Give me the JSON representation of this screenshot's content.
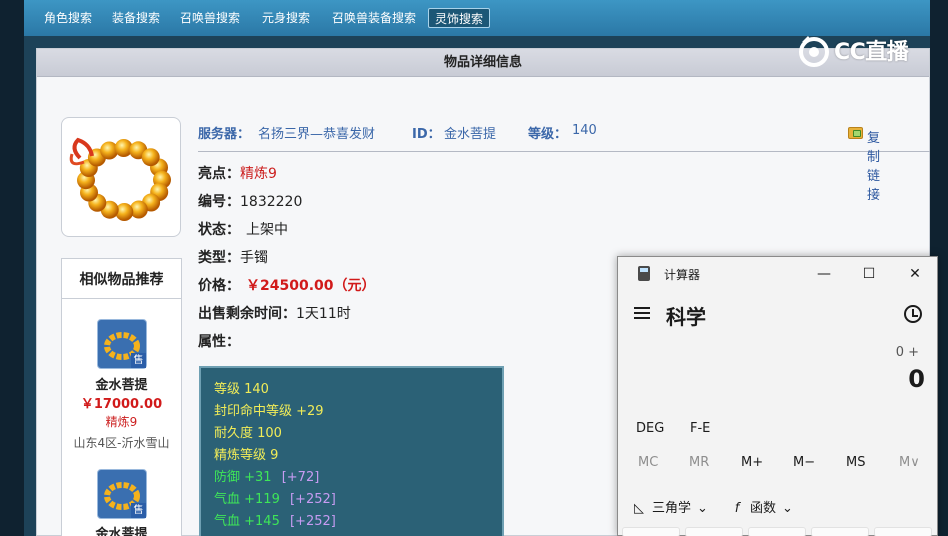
{
  "nav": {
    "tabs": [
      {
        "label": "角色搜索"
      },
      {
        "label": "装备搜索"
      },
      {
        "label": "召唤兽搜索"
      },
      {
        "label": "元身搜索"
      },
      {
        "label": "召唤兽装备搜索"
      },
      {
        "label": "灵饰搜索"
      }
    ],
    "active_tab": "灵饰搜索"
  },
  "watermark": {
    "brand": "CC直播"
  },
  "panel": {
    "title": "物品详细信息"
  },
  "info_head": {
    "server_label": "服务器：",
    "server_value": "名扬三界—恭喜发财",
    "id_label": "ID：",
    "id_value": "金水菩提",
    "level_label": "等级：",
    "level_value": "140",
    "copy_link": "复制链接"
  },
  "details": {
    "highlight_label": "亮点：",
    "highlight_value": "精炼9",
    "serial_label": "编号：",
    "serial_value": "1832220",
    "status_label": "状态：",
    "status_value": "上架中",
    "type_label": "类型：",
    "type_value": "手镯",
    "price_label": "价格：",
    "price_value": "￥24500.00（元）",
    "remain_label": "出售剩余时间：",
    "remain_value": "1天11时",
    "attr_label": "属性："
  },
  "attributes": [
    {
      "text": "等级 140"
    },
    {
      "text": "封印命中等级 +29"
    },
    {
      "text": "耐久度 100"
    },
    {
      "text": "精炼等级 9"
    },
    {
      "text": "防御 +31",
      "extra": "[+72]"
    },
    {
      "text": "气血 +119",
      "extra": "[+252]"
    },
    {
      "text": "气血 +145",
      "extra": "[+252]"
    }
  ],
  "similar": {
    "title": "相似物品推荐",
    "sale_badge": "售",
    "items": [
      {
        "name": "金水菩提",
        "price": "￥17000.00",
        "refine": "精炼9",
        "server": "山东4区-沂水雪山"
      },
      {
        "name": "金水菩提"
      }
    ]
  },
  "calculator": {
    "title": "计算器",
    "mode": "科学",
    "expression": "0 +",
    "result": "0",
    "angle_button": "DEG",
    "fe_button": "F-E",
    "memory": [
      "MC",
      "MR",
      "M+",
      "M−",
      "MS",
      "M∨"
    ],
    "trig_label": "三角学",
    "func_label": "函数"
  }
}
